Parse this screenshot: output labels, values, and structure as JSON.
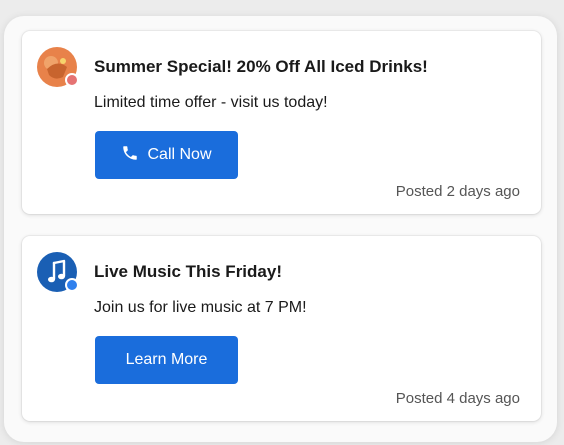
{
  "colors": {
    "accent": "#1a6ddc",
    "avatar1_bg": "#e8824a",
    "avatar1_badge": "#e57373",
    "avatar2_bg": "#1a5fb4",
    "avatar2_badge": "#2f80ed"
  },
  "notifications": [
    {
      "avatar_icon": "summer-drink-avatar-icon",
      "title": "Summer Special! 20% Off All Iced Drinks!",
      "message": "Limited time offer - visit us today!",
      "button_icon": "phone-icon",
      "button_label": "Call Now",
      "posted": "Posted 2 days ago"
    },
    {
      "avatar_icon": "music-note-avatar-icon",
      "title": "Live Music This Friday!",
      "message": "Join us for live music at 7 PM!",
      "button_label": "Learn More",
      "posted": "Posted 4 days ago"
    }
  ]
}
